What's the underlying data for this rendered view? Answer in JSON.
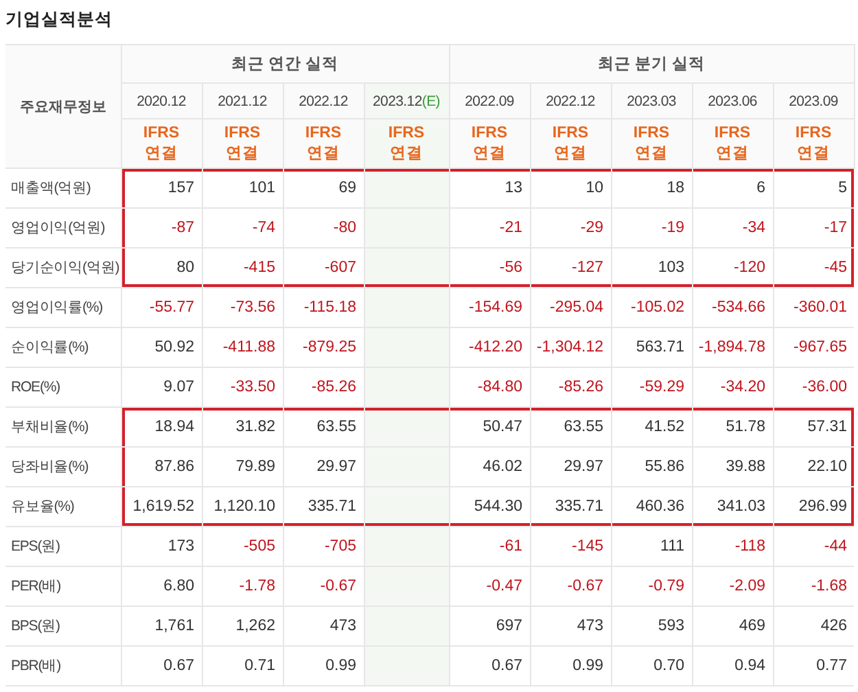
{
  "title": "기업실적분석",
  "corner_header": "주요재무정보",
  "groups": [
    {
      "heading": "최근 연간 실적",
      "periods": [
        {
          "label": "2020.12",
          "estimate": false,
          "basis": "IFRS",
          "scope": "연결"
        },
        {
          "label": "2021.12",
          "estimate": false,
          "basis": "IFRS",
          "scope": "연결"
        },
        {
          "label": "2022.12",
          "estimate": false,
          "basis": "IFRS",
          "scope": "연결"
        },
        {
          "label": "2023.12",
          "estimate": true,
          "mark": "(E)",
          "basis": "IFRS",
          "scope": "연결"
        }
      ]
    },
    {
      "heading": "최근 분기 실적",
      "periods": [
        {
          "label": "2022.09",
          "estimate": false,
          "basis": "IFRS",
          "scope": "연결"
        },
        {
          "label": "2022.12",
          "estimate": false,
          "basis": "IFRS",
          "scope": "연결"
        },
        {
          "label": "2023.03",
          "estimate": false,
          "basis": "IFRS",
          "scope": "연결"
        },
        {
          "label": "2023.06",
          "estimate": false,
          "basis": "IFRS",
          "scope": "연결"
        },
        {
          "label": "2023.09",
          "estimate": false,
          "basis": "IFRS",
          "scope": "연결"
        }
      ]
    }
  ],
  "rows": [
    {
      "label": "매출액(억원)",
      "highlighted": true,
      "cells": [
        [
          {
            "text": "157",
            "negative": false
          },
          {
            "text": "101",
            "negative": false
          },
          {
            "text": "69",
            "negative": false
          }
        ],
        [
          {
            "text": "13",
            "negative": false
          },
          {
            "text": "10",
            "negative": false
          },
          {
            "text": "18",
            "negative": false
          },
          {
            "text": "6",
            "negative": false
          },
          {
            "text": "5",
            "negative": false
          }
        ]
      ]
    },
    {
      "label": "영업이익(억원)",
      "highlighted": true,
      "cells": [
        [
          {
            "text": "-87",
            "negative": true
          },
          {
            "text": "-74",
            "negative": true
          },
          {
            "text": "-80",
            "negative": true
          }
        ],
        [
          {
            "text": "-21",
            "negative": true
          },
          {
            "text": "-29",
            "negative": true
          },
          {
            "text": "-19",
            "negative": true
          },
          {
            "text": "-34",
            "negative": true
          },
          {
            "text": "-17",
            "negative": true
          }
        ]
      ]
    },
    {
      "label": "당기순이익(억원)",
      "highlighted": true,
      "cells": [
        [
          {
            "text": "80",
            "negative": false
          },
          {
            "text": "-415",
            "negative": true
          },
          {
            "text": "-607",
            "negative": true
          }
        ],
        [
          {
            "text": "-56",
            "negative": true
          },
          {
            "text": "-127",
            "negative": true
          },
          {
            "text": "103",
            "negative": false
          },
          {
            "text": "-120",
            "negative": true
          },
          {
            "text": "-45",
            "negative": true
          }
        ]
      ]
    },
    {
      "label": "영업이익률(%)",
      "highlighted": false,
      "cells": [
        [
          {
            "text": "-55.77",
            "negative": true
          },
          {
            "text": "-73.56",
            "negative": true
          },
          {
            "text": "-115.18",
            "negative": true
          }
        ],
        [
          {
            "text": "-154.69",
            "negative": true
          },
          {
            "text": "-295.04",
            "negative": true
          },
          {
            "text": "-105.02",
            "negative": true
          },
          {
            "text": "-534.66",
            "negative": true
          },
          {
            "text": "-360.01",
            "negative": true
          }
        ]
      ]
    },
    {
      "label": "순이익률(%)",
      "highlighted": false,
      "cells": [
        [
          {
            "text": "50.92",
            "negative": false
          },
          {
            "text": "-411.88",
            "negative": true
          },
          {
            "text": "-879.25",
            "negative": true
          }
        ],
        [
          {
            "text": "-412.20",
            "negative": true
          },
          {
            "text": "-1,304.12",
            "negative": true
          },
          {
            "text": "563.71",
            "negative": false
          },
          {
            "text": "-1,894.78",
            "negative": true
          },
          {
            "text": "-967.65",
            "negative": true
          }
        ]
      ]
    },
    {
      "label": "ROE(%)",
      "highlighted": false,
      "cells": [
        [
          {
            "text": "9.07",
            "negative": false
          },
          {
            "text": "-33.50",
            "negative": true
          },
          {
            "text": "-85.26",
            "negative": true
          }
        ],
        [
          {
            "text": "-84.80",
            "negative": true
          },
          {
            "text": "-85.26",
            "negative": true
          },
          {
            "text": "-59.29",
            "negative": true
          },
          {
            "text": "-34.20",
            "negative": true
          },
          {
            "text": "-36.00",
            "negative": true
          }
        ]
      ]
    },
    {
      "label": "부채비율(%)",
      "highlighted": true,
      "cells": [
        [
          {
            "text": "18.94",
            "negative": false
          },
          {
            "text": "31.82",
            "negative": false
          },
          {
            "text": "63.55",
            "negative": false
          }
        ],
        [
          {
            "text": "50.47",
            "negative": false
          },
          {
            "text": "63.55",
            "negative": false
          },
          {
            "text": "41.52",
            "negative": false
          },
          {
            "text": "51.78",
            "negative": false
          },
          {
            "text": "57.31",
            "negative": false
          }
        ]
      ]
    },
    {
      "label": "당좌비율(%)",
      "highlighted": true,
      "cells": [
        [
          {
            "text": "87.86",
            "negative": false
          },
          {
            "text": "79.89",
            "negative": false
          },
          {
            "text": "29.97",
            "negative": false
          }
        ],
        [
          {
            "text": "46.02",
            "negative": false
          },
          {
            "text": "29.97",
            "negative": false
          },
          {
            "text": "55.86",
            "negative": false
          },
          {
            "text": "39.88",
            "negative": false
          },
          {
            "text": "22.10",
            "negative": false
          }
        ]
      ]
    },
    {
      "label": "유보율(%)",
      "highlighted": true,
      "cells": [
        [
          {
            "text": "1,619.52",
            "negative": false
          },
          {
            "text": "1,120.10",
            "negative": false
          },
          {
            "text": "335.71",
            "negative": false
          }
        ],
        [
          {
            "text": "544.30",
            "negative": false
          },
          {
            "text": "335.71",
            "negative": false
          },
          {
            "text": "460.36",
            "negative": false
          },
          {
            "text": "341.03",
            "negative": false
          },
          {
            "text": "296.99",
            "negative": false
          }
        ]
      ]
    },
    {
      "label": "EPS(원)",
      "highlighted": false,
      "cells": [
        [
          {
            "text": "173",
            "negative": false
          },
          {
            "text": "-505",
            "negative": true
          },
          {
            "text": "-705",
            "negative": true
          }
        ],
        [
          {
            "text": "-61",
            "negative": true
          },
          {
            "text": "-145",
            "negative": true
          },
          {
            "text": "111",
            "negative": false
          },
          {
            "text": "-118",
            "negative": true
          },
          {
            "text": "-44",
            "negative": true
          }
        ]
      ]
    },
    {
      "label": "PER(배)",
      "highlighted": false,
      "cells": [
        [
          {
            "text": "6.80",
            "negative": false
          },
          {
            "text": "-1.78",
            "negative": true
          },
          {
            "text": "-0.67",
            "negative": true
          }
        ],
        [
          {
            "text": "-0.47",
            "negative": true
          },
          {
            "text": "-0.67",
            "negative": true
          },
          {
            "text": "-0.79",
            "negative": true
          },
          {
            "text": "-2.09",
            "negative": true
          },
          {
            "text": "-1.68",
            "negative": true
          }
        ]
      ]
    },
    {
      "label": "BPS(원)",
      "highlighted": false,
      "cells": [
        [
          {
            "text": "1,761",
            "negative": false
          },
          {
            "text": "1,262",
            "negative": false
          },
          {
            "text": "473",
            "negative": false
          }
        ],
        [
          {
            "text": "697",
            "negative": false
          },
          {
            "text": "473",
            "negative": false
          },
          {
            "text": "593",
            "negative": false
          },
          {
            "text": "469",
            "negative": false
          },
          {
            "text": "426",
            "negative": false
          }
        ]
      ]
    },
    {
      "label": "PBR(배)",
      "highlighted": false,
      "cells": [
        [
          {
            "text": "0.67",
            "negative": false
          },
          {
            "text": "0.71",
            "negative": false
          },
          {
            "text": "0.99",
            "negative": false
          }
        ],
        [
          {
            "text": "0.67",
            "negative": false
          },
          {
            "text": "0.99",
            "negative": false
          },
          {
            "text": "0.70",
            "negative": false
          },
          {
            "text": "0.94",
            "negative": false
          },
          {
            "text": "0.77",
            "negative": false
          }
        ]
      ]
    }
  ]
}
